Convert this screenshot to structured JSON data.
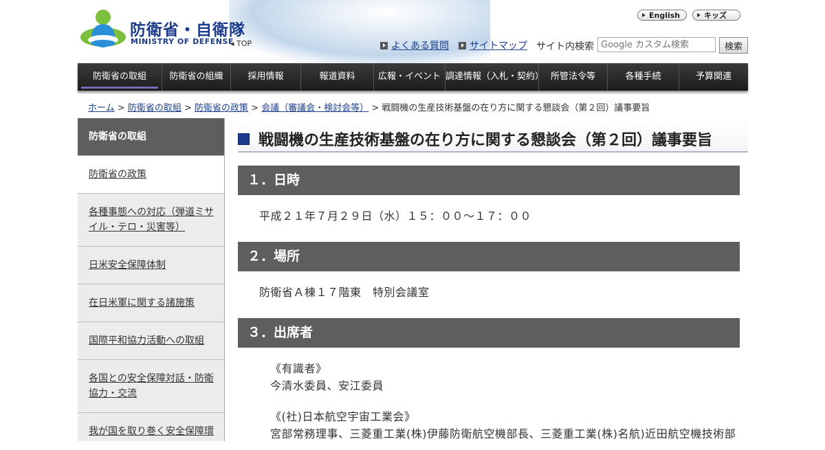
{
  "header": {
    "logo_ja": "防衛省・自衛隊",
    "logo_en": "MINISTRY OF DEFENSE",
    "top_link": "◂ TOP",
    "lang_english": "English",
    "lang_kids": "キッズ",
    "faq_link": "よくある質問",
    "sitemap_link": "サイトマップ",
    "search_label": "サイト内検索",
    "search_placeholder": "Google カスタム検索",
    "search_button": "検索",
    "colors": {
      "brand": "#1c3b8a",
      "logo_green": "#7cbf3a",
      "logo_blue": "#2a8fd8"
    }
  },
  "gnav": [
    "防衛省の取組",
    "防衛省の組織",
    "採用情報",
    "報道資料",
    "広報・イベント",
    "調達情報（入札・契約）",
    "所管法令等",
    "各種手続",
    "予算関連"
  ],
  "breadcrumb": {
    "items": [
      "ホーム",
      "防衛省の取組",
      "防衛省の政策",
      "会議（審議会・検討会等）"
    ],
    "separator": ">",
    "current": "戦闘機の生産技術基盤の在り方に関する懇談会（第２回）議事要旨"
  },
  "sidebar": {
    "heading": "防衛省の取組",
    "items": [
      "防衛省の政策",
      "各種事態への対応（弾道ミサイル・テロ・災害等）",
      "日米安全保障体制",
      "在日米軍に関する諸施策",
      "国際平和協力活動への取組",
      "各国との安全保障対話・防衛協力・交流",
      "我が国を取り巻く安全保障環"
    ]
  },
  "main": {
    "title": "戦闘機の生産技術基盤の在り方に関する懇談会（第２回）議事要旨",
    "sections": [
      {
        "heading": "１．日時",
        "lines": [
          "平成２１年７月２９日（水）１５：００～１７：００"
        ]
      },
      {
        "heading": "２．場所",
        "lines": [
          "防衛省Ａ棟１７階東　特別会議室"
        ]
      },
      {
        "heading": "３．出席者",
        "lines": [
          "《有識者》",
          "今清水委員、安江委員",
          "《(社)日本航空宇宙工業会》",
          "宮部常務理事、三菱重工業(株)伊藤防衛航空機部長、三菱重工業(株)名航)近田航空機技術部"
        ]
      }
    ]
  }
}
